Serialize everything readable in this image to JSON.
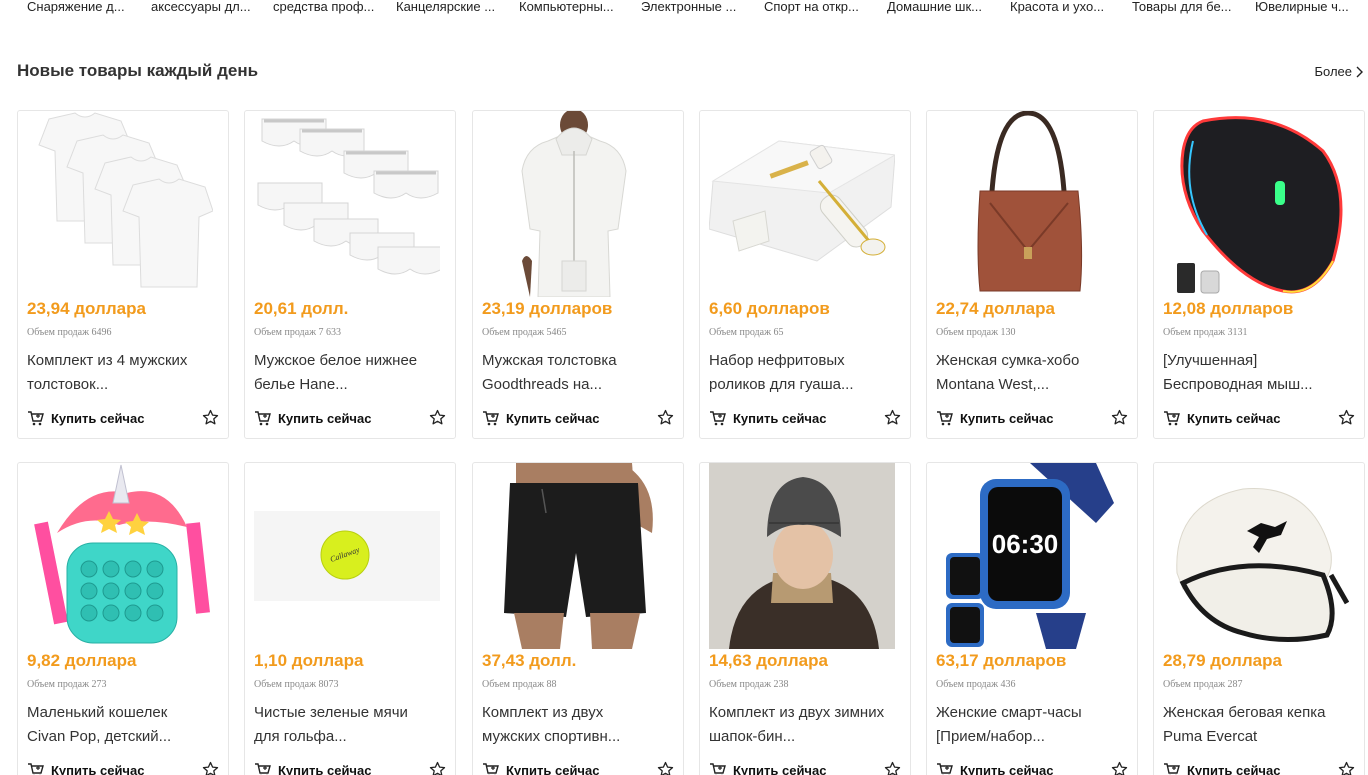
{
  "categories": [
    "Снаряжение д...",
    "аксессуары дл...",
    "средства проф...",
    "Канцелярские ...",
    "Компьютерны...",
    "Электронные ...",
    "Спорт на откр...",
    "Домашние шк...",
    "Красота и ухо...",
    "Товары для бе...",
    "Ювелирные ч..."
  ],
  "section": {
    "title": "Новые товары каждый день",
    "more": "Более"
  },
  "buy_label": "Купить сейчас",
  "accent_color": "#f29b1d",
  "products": [
    {
      "price": "23,94 доллара",
      "sales": "Объем продаж 6496",
      "name": "Комплект из 4 мужских толстовок...",
      "image": "white-tshirts"
    },
    {
      "price": "20,61 долл.",
      "sales": "Объем продаж 7 633",
      "name": "Мужское белое нижнее белье Hane...",
      "image": "white-briefs"
    },
    {
      "price": "23,19 долларов",
      "sales": "Объем продаж 5465",
      "name": "Мужская толстовка Goodthreads на...",
      "image": "white-hoodie"
    },
    {
      "price": "6,60 долларов",
      "sales": "Объем продаж 65",
      "name": "Набор нефритовых роликов для гуаша...",
      "image": "jade-roller"
    },
    {
      "price": "22,74 доллара",
      "sales": "Объем продаж 130",
      "name": "Женская сумка-хобо Montana West,...",
      "image": "brown-bag"
    },
    {
      "price": "12,08 долларов",
      "sales": "Объем продаж 3131",
      "name": "[Улучшенная] Беспроводная мыш...",
      "image": "rgb-mouse"
    },
    {
      "price": "9,82 доллара",
      "sales": "Объем продаж 273",
      "name": "Маленький кошелек Civan Pop, детский...",
      "image": "unicorn-purse"
    },
    {
      "price": "1,10 доллара",
      "sales": "Объем продаж 8073",
      "name": "Чистые зеленые мячи для гольфа...",
      "image": "golf-ball"
    },
    {
      "price": "37,43 долл.",
      "sales": "Объем продаж 88",
      "name": "Комплект из двух мужских спортивн...",
      "image": "black-shorts"
    },
    {
      "price": "14,63 доллара",
      "sales": "Объем продаж 238",
      "name": "Комплект из двух зимних шапок-бин...",
      "image": "beanie-hat"
    },
    {
      "price": "63,17 долларов",
      "sales": "Объем продаж 436",
      "name": "Женские смарт-часы [Прием/набор...",
      "image": "smartwatch"
    },
    {
      "price": "28,79 доллара",
      "sales": "Объем продаж 287",
      "name": "Женская беговая кепка Puma Evercat",
      "image": "white-cap"
    }
  ],
  "image_text": {
    "watch_time": "06:30",
    "ball_brand": "Callaway"
  }
}
